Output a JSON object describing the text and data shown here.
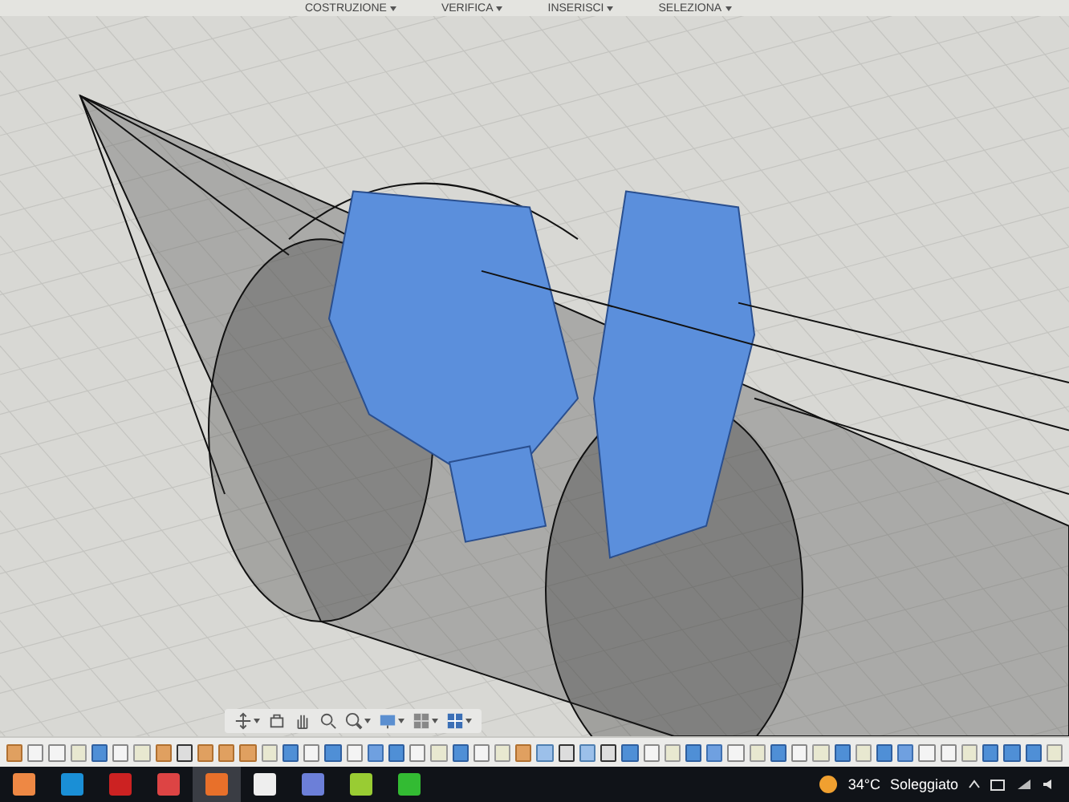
{
  "menu": [
    {
      "label": "COSTRUZIONE"
    },
    {
      "label": "VERIFICA"
    },
    {
      "label": "INSERISCI"
    },
    {
      "label": "SELEZIONA"
    }
  ],
  "nav_toolbar": [
    {
      "kind": "orbit",
      "dropdown": true
    },
    {
      "kind": "look",
      "dropdown": false
    },
    {
      "kind": "pan",
      "dropdown": false
    },
    {
      "kind": "zoom",
      "dropdown": false
    },
    {
      "kind": "fit",
      "dropdown": true
    },
    {
      "kind": "display",
      "dropdown": true
    },
    {
      "kind": "grid",
      "dropdown": true
    },
    {
      "kind": "viewports",
      "dropdown": true
    }
  ],
  "timeline": [
    {
      "kind": "extrude"
    },
    {
      "kind": "sketch"
    },
    {
      "kind": "sketch"
    },
    {
      "kind": "plane"
    },
    {
      "kind": "body"
    },
    {
      "kind": "sketch"
    },
    {
      "kind": "plane"
    },
    {
      "kind": "extrude"
    },
    {
      "kind": "joint"
    },
    {
      "kind": "extrude"
    },
    {
      "kind": "extrude"
    },
    {
      "kind": "extrude"
    },
    {
      "kind": "plane"
    },
    {
      "kind": "body"
    },
    {
      "kind": "sketch"
    },
    {
      "kind": "body"
    },
    {
      "kind": "sketch"
    },
    {
      "kind": "cone"
    },
    {
      "kind": "body"
    },
    {
      "kind": "sketch"
    },
    {
      "kind": "plane"
    },
    {
      "kind": "body"
    },
    {
      "kind": "sketch"
    },
    {
      "kind": "plane"
    },
    {
      "kind": "extrude"
    },
    {
      "kind": "cylinder"
    },
    {
      "kind": "joint"
    },
    {
      "kind": "cylinder"
    },
    {
      "kind": "joint"
    },
    {
      "kind": "body"
    },
    {
      "kind": "sketch"
    },
    {
      "kind": "plane"
    },
    {
      "kind": "body"
    },
    {
      "kind": "cone"
    },
    {
      "kind": "sketch"
    },
    {
      "kind": "plane"
    },
    {
      "kind": "body"
    },
    {
      "kind": "sketch"
    },
    {
      "kind": "plane"
    },
    {
      "kind": "body"
    },
    {
      "kind": "plane"
    },
    {
      "kind": "body"
    },
    {
      "kind": "cone"
    },
    {
      "kind": "sketch"
    },
    {
      "kind": "sketch"
    },
    {
      "kind": "plane"
    },
    {
      "kind": "body"
    },
    {
      "kind": "body"
    },
    {
      "kind": "body"
    },
    {
      "kind": "plane"
    }
  ],
  "taskbar_apps": [
    {
      "kind": "browser",
      "active": false
    },
    {
      "kind": "c-app",
      "active": false
    },
    {
      "kind": "sw-app",
      "active": false
    },
    {
      "kind": "house-app",
      "active": false
    },
    {
      "kind": "f-app",
      "active": true
    },
    {
      "kind": "ring-app",
      "active": false
    },
    {
      "kind": "e-app",
      "active": false
    },
    {
      "kind": "frame-app",
      "active": false
    },
    {
      "kind": "green-app",
      "active": false
    }
  ],
  "weather": {
    "temperature": "34°C",
    "condition": "Soleggiato"
  }
}
